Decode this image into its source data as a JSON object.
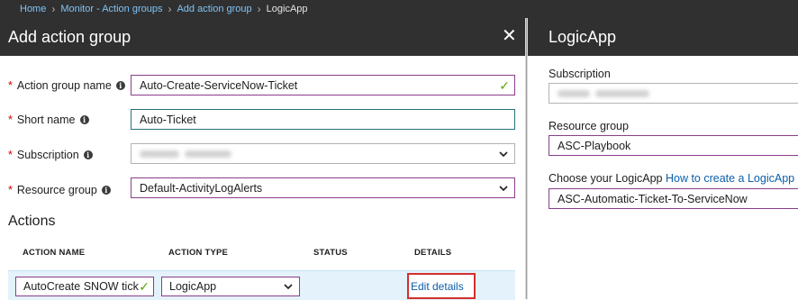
{
  "breadcrumb": {
    "items": [
      "Home",
      "Monitor - Action groups",
      "Add action group"
    ],
    "current": "LogicApp"
  },
  "left_panel": {
    "title": "Add action group",
    "close_icon": "close-icon",
    "form": {
      "action_group_name": {
        "label": "Action group name",
        "value": "Auto-Create-ServiceNow-Ticket"
      },
      "short_name": {
        "label": "Short name",
        "value": "Auto-Ticket"
      },
      "subscription": {
        "label": "Subscription",
        "value": ""
      },
      "resource_group": {
        "label": "Resource group",
        "value": "Default-ActivityLogAlerts"
      }
    },
    "actions": {
      "title": "Actions",
      "columns": [
        "ACTION NAME",
        "ACTION TYPE",
        "STATUS",
        "DETAILS"
      ],
      "rows": [
        {
          "name": "AutoCreate SNOW tick",
          "type": "LogicApp",
          "status": "",
          "details": "Edit details"
        }
      ]
    }
  },
  "right_panel": {
    "title": "LogicApp",
    "subscription": {
      "label": "Subscription",
      "value": ""
    },
    "resource_group": {
      "label": "Resource group",
      "value": "ASC-Playbook"
    },
    "logicapp": {
      "label": "Choose your LogicApp",
      "link": "How to create a LogicApp",
      "value": "ASC-Automatic-Ticket-To-ServiceNow"
    }
  },
  "colors": {
    "header_bg": "#303030",
    "link": "#0b5eaa",
    "breadcrumb_link": "#7fc4f6",
    "field_border": "#8a3e8a",
    "required": "#d00000",
    "valid_check": "#57a300",
    "highlight_box": "#d32f2f",
    "selected_row": "#e4f2fb"
  }
}
